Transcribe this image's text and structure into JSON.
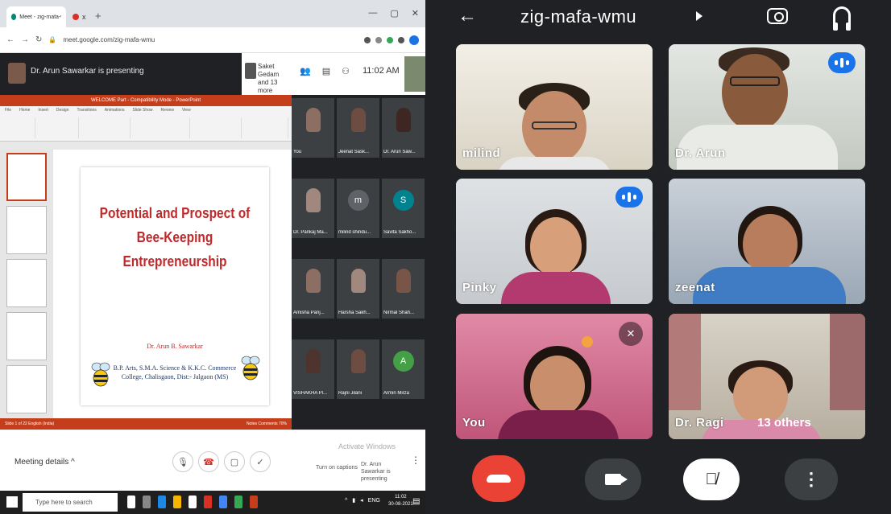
{
  "desktop": {
    "browser": {
      "active_tab_label": "Meet - zig-mafa-wmu",
      "second_tab_label": "x",
      "new_tab": "+",
      "url": "meet.google.com/zig-mafa-wmu",
      "window_controls": [
        "—",
        "▢",
        "✕"
      ]
    },
    "meet": {
      "presenter_label": "Dr. Arun Sawarkar is presenting",
      "participants_summary": "Saket Gedam and 13 more",
      "time": "11:02 AM",
      "powerpoint": {
        "title_bar": "WELCOME Part - Compatibility Mode - PowerPoint",
        "ribbon_tabs": [
          "File",
          "Home",
          "Insert",
          "Design",
          "Transitions",
          "Animations",
          "Slide Show",
          "Review",
          "View"
        ],
        "status_left": "Slide 1 of 22   English (India)",
        "status_right": "Notes  Comments  70%"
      },
      "slide": {
        "title": "Potential and Prospect of Bee-Keeping Entrepreneurship",
        "author": "Dr. Arun B. Sawarkar",
        "college": "B.P. Arts, S.M.A. Science & K.K.C. Commerce College, Chalisgaon, Dist:- Jalgaon (MS)"
      },
      "grid_tiles": [
        {
          "label": "You",
          "avatar": "",
          "color": "#5d4037"
        },
        {
          "label": "Jeenat Sask...",
          "avatar": "",
          "color": "#4e342e"
        },
        {
          "label": "Dr. Arun Saw...",
          "avatar": "",
          "color": "#3e2723"
        },
        {
          "label": "Dr. Pankaj Ma...",
          "avatar": "",
          "color": "#6d4c41"
        },
        {
          "label": "milind shindu...",
          "avatar": "m",
          "color": "#5f6368"
        },
        {
          "label": "Savita Sakho...",
          "avatar": "S",
          "color": "#00838f"
        },
        {
          "label": "Amisha Panj...",
          "avatar": "",
          "color": "#8d6e63"
        },
        {
          "label": "Harsha Sakh...",
          "avatar": "",
          "color": "#a1887f"
        },
        {
          "label": "Nirmal Shah...",
          "avatar": "",
          "color": "#795548"
        },
        {
          "label": "VISHAKHA Pl...",
          "avatar": "",
          "color": "#4e342e"
        },
        {
          "label": "Rajni Jilani",
          "avatar": "",
          "color": "#6d4c41"
        },
        {
          "label": "Armin Mirza",
          "avatar": "A",
          "color": "#43a047"
        }
      ],
      "meeting_details": "Meeting details ^",
      "captions_label": "Turn on captions",
      "present_label": "Dr. Arun Sawarkar is presenting",
      "watermark": "Activate Windows",
      "more": "⋮"
    },
    "taskbar": {
      "search_placeholder": "Type here to search",
      "clock_time": "11:02",
      "clock_date": "30-08-2021",
      "lang": "ENG"
    }
  },
  "mobile": {
    "meeting_code": "zig-mafa-wmu",
    "tiles": [
      {
        "name": "milind",
        "speaking": false,
        "muted": false
      },
      {
        "name": "Dr. Arun",
        "speaking": true,
        "muted": false
      },
      {
        "name": "Pinky",
        "speaking": true,
        "muted": false
      },
      {
        "name": "zeenat",
        "speaking": false,
        "muted": false
      },
      {
        "name": "You",
        "speaking": false,
        "muted": true
      },
      {
        "name": "Dr. Ragi",
        "speaking": false,
        "muted": false
      }
    ],
    "others_label": "13 others",
    "icons": {
      "back": "back-arrow-icon",
      "switch_camera": "switch-camera-icon",
      "audio": "headphones-icon",
      "hangup": "hang-up-icon",
      "video": "video-camera-icon",
      "mic": "mic-off-icon",
      "more": "more-vertical-icon"
    },
    "colors": {
      "background": "#202124",
      "hangup": "#ea4335",
      "speaking": "#1a73e8"
    }
  }
}
